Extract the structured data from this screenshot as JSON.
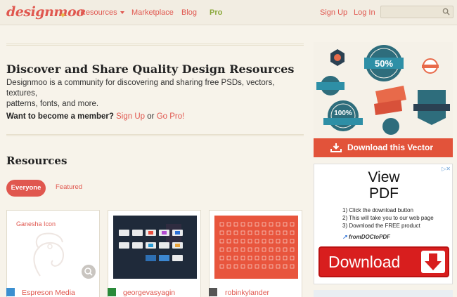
{
  "header": {
    "logo": "designmoo",
    "nav": {
      "resources": "Resources",
      "marketplace": "Marketplace",
      "blog": "Blog",
      "pro": "Pro"
    },
    "auth": {
      "signup": "Sign Up",
      "login": "Log In"
    },
    "search": {
      "placeholder": ""
    }
  },
  "hero": {
    "title": "Discover and Share Quality Design Resources",
    "desc_line1": "Designmoo is a community for discovering and sharing free PSDs, vectors, textures,",
    "desc_line2": "patterns, fonts, and more.",
    "member_question": "Want to become a member?",
    "signup_link": "Sign Up",
    "or": "or",
    "gopro_link": "Go Pro!"
  },
  "resources": {
    "title": "Resources",
    "filters": {
      "everyone": "Everyone",
      "featured": "Featured"
    },
    "cards": [
      {
        "thumb_title": "Ganesha Icon",
        "user": "Espreson Media"
      },
      {
        "thumb_title": "",
        "user": "georgevasyagin"
      },
      {
        "thumb_title": "",
        "user": "robinkylander"
      }
    ]
  },
  "ads": {
    "vector": {
      "download_label": "Download this Vector",
      "badge_50": "50%",
      "badge_100": "100%"
    },
    "pdf": {
      "title_line1": "View",
      "title_line2": "PDF",
      "step1": "1) Click the download button",
      "step2": "2) This will take you to our web page",
      "step3": "3) Download the FREE product",
      "brand": "fromDOCtoPDF",
      "button": "Download",
      "adchoice": "▷✕"
    }
  },
  "colors": {
    "accent": "#e0574f",
    "pro": "#8aa83a",
    "background": "#f7f3ea"
  }
}
